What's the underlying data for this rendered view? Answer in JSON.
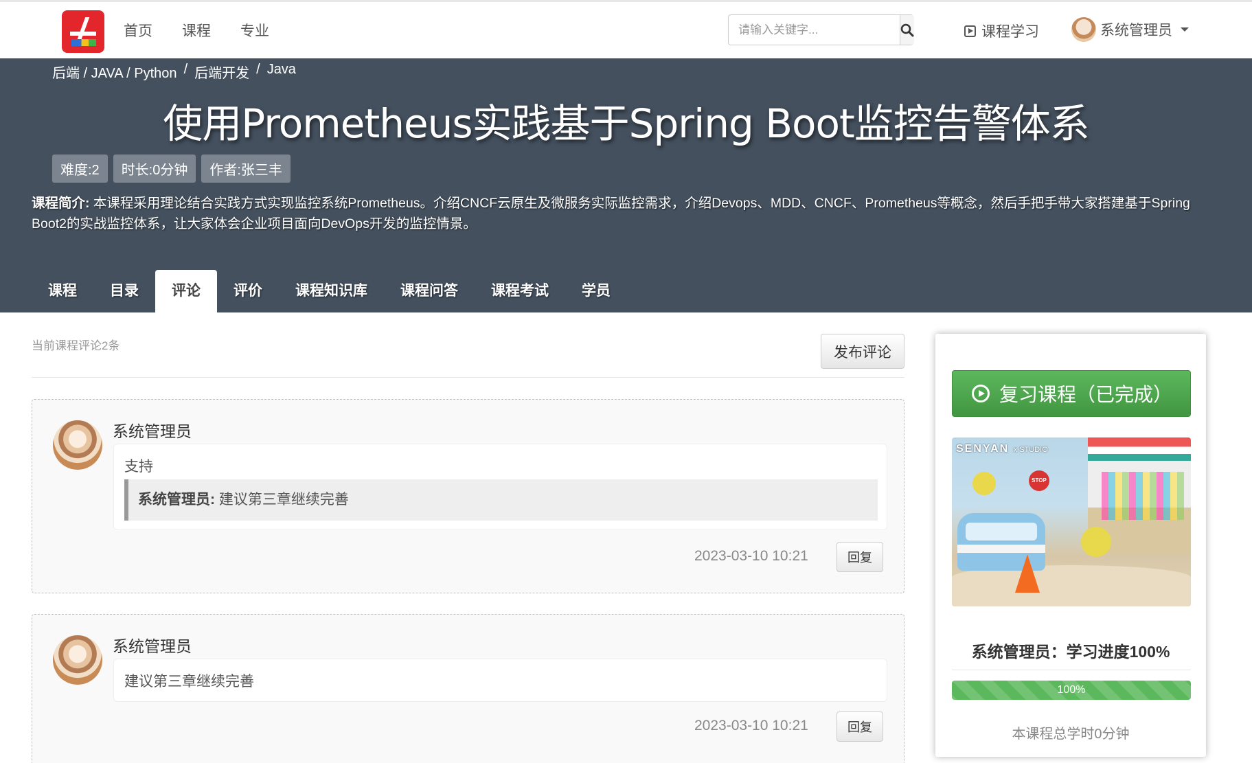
{
  "nav": {
    "links": [
      "首页",
      "课程",
      "专业"
    ],
    "search_placeholder": "请输入关键字...",
    "learn_label": "课程学习",
    "user_name": "系统管理员"
  },
  "breadcrumb": {
    "parts": [
      "后端 / JAVA / Python",
      "/",
      "后端开发",
      "/",
      "Java"
    ]
  },
  "course": {
    "title": "使用Prometheus实践基于Spring Boot监控告警体系",
    "tags": [
      "难度:2",
      "时长:0分钟",
      "作者:张三丰"
    ],
    "intro_label": "课程简介:",
    "intro_text": " 本课程采用理论结合实践方式实现监控系统Prometheus。介绍CNCF云原生及微服务实际监控需求，介绍Devops、MDD、CNCF、Prometheus等概念，然后手把手带大家搭建基于Spring Boot2的实战监控体系，让大家体会企业项目面向DevOps开发的监控情景。"
  },
  "tabs": [
    "课程",
    "目录",
    "评论",
    "评价",
    "课程知识库",
    "课程问答",
    "课程考试",
    "学员"
  ],
  "active_tab": "评论",
  "comments_header": {
    "count_text": "当前课程评论2条",
    "publish_label": "发布评论"
  },
  "comments": [
    {
      "author": "系统管理员",
      "text": "支持",
      "reply_author": "系统管理员:",
      "reply_text": " 建议第三章继续完善",
      "time": "2023-03-10 10:21",
      "reply_button": "回复"
    },
    {
      "author": "系统管理员",
      "text": "建议第三章继续完善",
      "time": "2023-03-10 10:21",
      "reply_button": "回复"
    }
  ],
  "sidebar": {
    "review_button": "复习课程（已完成）",
    "cover_brand": "SENYAN",
    "cover_brand_suffix": "x STUDIO",
    "cover_stop": "STOP",
    "progress_text": "系统管理员：学习进度100%",
    "progress_value": 100,
    "progress_bar_label": "100%",
    "total_time": "本课程总学时0分钟"
  },
  "colors": {
    "hero_bg": "#44505e",
    "success": "#5cb85c",
    "brand_red": "#e2262b"
  }
}
